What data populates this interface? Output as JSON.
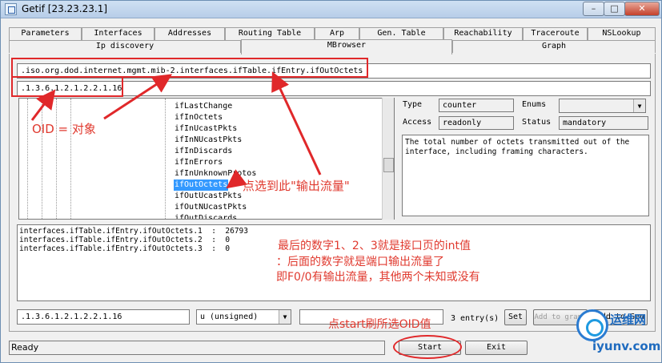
{
  "window": {
    "title": "Getif [23.23.23.1]",
    "controls": {
      "minimize": "–",
      "maximize": "□",
      "close": "✕"
    }
  },
  "tabs": {
    "row1": [
      "Parameters",
      "Interfaces",
      "Addresses",
      "Routing Table",
      "Arp",
      "Gen. Table",
      "Reachability",
      "Traceroute",
      "NSLookup"
    ],
    "row2": [
      "Ip discovery",
      "MBrowser",
      "Graph"
    ],
    "active": "MBrowser"
  },
  "mbrowser": {
    "oid_path": ".iso.org.dod.internet.mgmt.mib-2.interfaces.ifTable.ifEntry.ifOutOctets",
    "oid_numeric": ".1.3.6.1.2.1.2.2.1.16",
    "tree_items": [
      "ifLastChange",
      "ifInOctets",
      "ifInUcastPkts",
      "ifInNUcastPkts",
      "ifInDiscards",
      "ifInErrors",
      "ifInUnknownProtos",
      "ifOutOctets",
      "ifOutUcastPkts",
      "ifOutNUcastPkts",
      "ifOutDiscards"
    ],
    "selected_item": "ifOutOctets",
    "type_label": "Type",
    "type_value": "counter",
    "enums_label": "Enums",
    "enums_value": "",
    "access_label": "Access",
    "access_value": "readonly",
    "status_label": "Status",
    "status_value": "mandatory",
    "description": "The total number of octets transmitted out of the interface, including framing characters.",
    "output_rows": [
      "interfaces.ifTable.ifEntry.ifOutOctets.1  :  26793",
      "interfaces.ifTable.ifEntry.ifOutOctets.2  :  0",
      "interfaces.ifTable.ifEntry.ifOutOctets.3  :  0"
    ],
    "set_oid_value": ".1.3.6.1.2.1.2.2.1.16",
    "set_type_value": "u (unsigned)",
    "set_value": "",
    "entry_count": "3 entry(s)",
    "set_button": "Set",
    "add_graph_button": "Add to graph",
    "add_gen_button": "Add to Gen",
    "start_button": "Start",
    "exit_button": "Exit",
    "status_text": "Ready"
  },
  "annotations": {
    "oid_label": "OID  =    对象",
    "select_note": "点选到此\"输出流量\"",
    "result_note_1": "最后的数字1、2、3就是接口页的int值",
    "result_note_2": "：后面的数字就是端口输出流量了",
    "result_note_3": "即F0/0有输出流量，其他两个未知或没有",
    "start_note": "点start刷所选OID值",
    "color": "#e0282a"
  },
  "watermark": {
    "name": "运维网",
    "url": "iyunv.com"
  }
}
